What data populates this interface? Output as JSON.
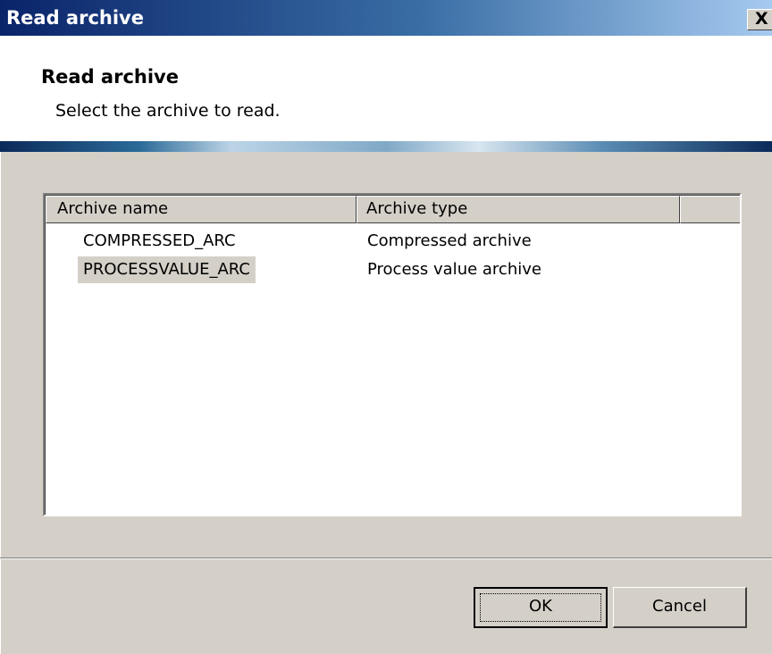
{
  "window": {
    "title": "Read archive",
    "close_glyph": "X"
  },
  "header": {
    "title": "Read archive",
    "subtitle": "Select the archive to read."
  },
  "list": {
    "columns": [
      "Archive name",
      "Archive type",
      ""
    ],
    "rows": [
      {
        "name": "COMPRESSED_ARC",
        "type": "Compressed archive",
        "selected": false
      },
      {
        "name": "PROCESSVALUE_ARC",
        "type": "Process value archive",
        "selected": true
      }
    ]
  },
  "buttons": {
    "ok": "OK",
    "cancel": "Cancel"
  },
  "icons": {
    "close": "close-icon"
  }
}
